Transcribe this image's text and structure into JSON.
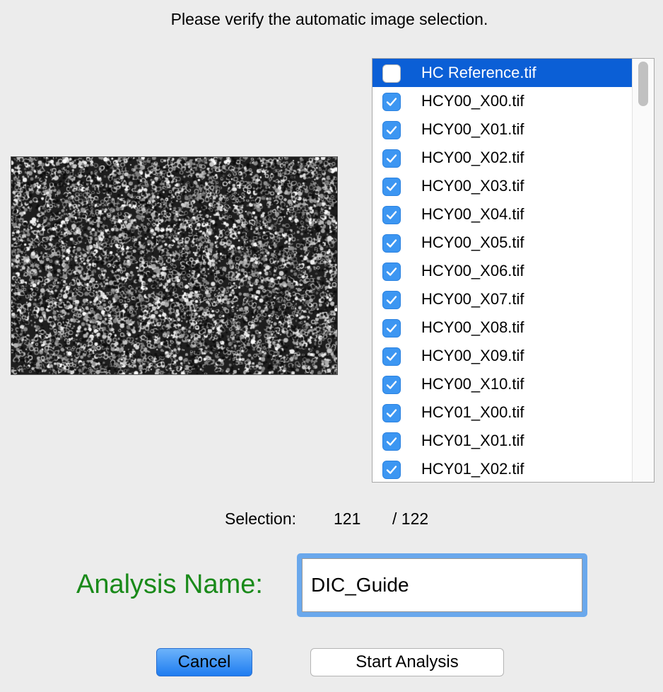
{
  "instruction": "Please verify the automatic image selection.",
  "files": [
    {
      "name": "HC Reference.tif",
      "checked": false,
      "selected": true
    },
    {
      "name": "HCY00_X00.tif",
      "checked": true,
      "selected": false
    },
    {
      "name": "HCY00_X01.tif",
      "checked": true,
      "selected": false
    },
    {
      "name": "HCY00_X02.tif",
      "checked": true,
      "selected": false
    },
    {
      "name": "HCY00_X03.tif",
      "checked": true,
      "selected": false
    },
    {
      "name": "HCY00_X04.tif",
      "checked": true,
      "selected": false
    },
    {
      "name": "HCY00_X05.tif",
      "checked": true,
      "selected": false
    },
    {
      "name": "HCY00_X06.tif",
      "checked": true,
      "selected": false
    },
    {
      "name": "HCY00_X07.tif",
      "checked": true,
      "selected": false
    },
    {
      "name": "HCY00_X08.tif",
      "checked": true,
      "selected": false
    },
    {
      "name": "HCY00_X09.tif",
      "checked": true,
      "selected": false
    },
    {
      "name": "HCY00_X10.tif",
      "checked": true,
      "selected": false
    },
    {
      "name": "HCY01_X00.tif",
      "checked": true,
      "selected": false
    },
    {
      "name": "HCY01_X01.tif",
      "checked": true,
      "selected": false
    },
    {
      "name": "HCY01_X02.tif",
      "checked": true,
      "selected": false
    }
  ],
  "selection": {
    "label": "Selection:",
    "count": "121",
    "total": "/ 122"
  },
  "analysis": {
    "label": "Analysis Name:",
    "value": "DIC_Guide"
  },
  "buttons": {
    "cancel": "Cancel",
    "start": "Start Analysis"
  },
  "colors": {
    "accent": "#0b5fd6",
    "checkbox": "#3c96f2",
    "label_green": "#1a8a1a",
    "background": "#ececec"
  },
  "icons": {
    "checkbox_checked": "checkmark-icon"
  }
}
